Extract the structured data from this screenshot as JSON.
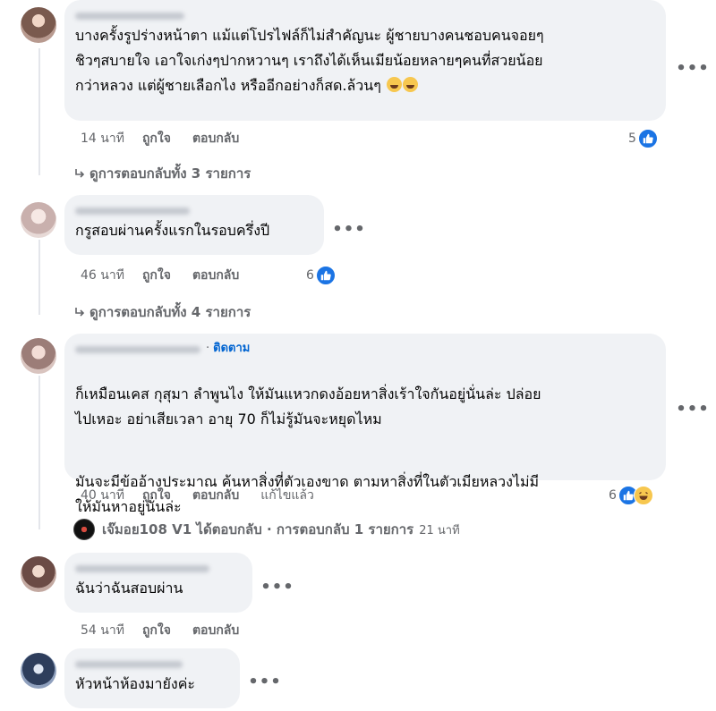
{
  "comments": [
    {
      "text": "บางครั้งรูปร่างหน้าตา แม้แต่โปรไฟล์ก็ไม่สำคัญนะ ผู้ชายบางคนชอบคนจอยๆ\nชิวๆสบายใจ เอาใจเก่งๆปากหวานๆ เราถึงได้เห็นเมียน้อยหลายๆคนที่สวยน้อย\nกว่าหลวง แต่ผู้ชายเลือกไง หรืออีกอย่างก็สด.ล้วนๆ",
      "time": "14 นาที",
      "like_label": "ถูกใจ",
      "reply_label": "ตอบกลับ",
      "reaction_count": "5",
      "view_replies": "ดูการตอบกลับทั้ง 3 รายการ"
    },
    {
      "text": "กรูสอบผ่านครั้งแรกในรอบครึ่งปี",
      "time": "46 นาที",
      "like_label": "ถูกใจ",
      "reply_label": "ตอบกลับ",
      "reaction_count": "6",
      "view_replies": "ดูการตอบกลับทั้ง 4 รายการ"
    },
    {
      "follow_sep": "·",
      "follow_label": "ติดตาม",
      "paragraph1": "ก็เหมือนเคส กุสุมา ลำพูนไง ให้มันแหวกดงอ้อยหาสิ่งเร้าใจกันอยู่นั่นล่ะ ปล่อย\nไปเหอะ อย่าเสียเวลา อายุ 70 ก็ไม่รู้มันจะหยุดไหม",
      "paragraph2": "มันจะมีข้ออ้างประมาณ ค้นหาสิ่งที่ตัวเองขาด ตามหาสิ่งที่ในตัวเมียหลวงไม่มี\nให้มันหาอยู่นั่นล่ะ",
      "time": "40 นาที",
      "like_label": "ถูกใจ",
      "reply_label": "ตอบกลับ",
      "edited_label": "แก้ไขแล้ว",
      "reaction_count": "6",
      "reply_summary": "เจ๊มอย108 V1 ได้ตอบกลับ · การตอบกลับ 1 รายการ",
      "reply_summary_time": "21 นาที"
    },
    {
      "text": "ฉันว่าฉันสอบผ่าน",
      "time": "54 นาที",
      "like_label": "ถูกใจ",
      "reply_label": "ตอบกลับ"
    },
    {
      "text": "หัวหน้าห้องมายังค่ะ"
    }
  ],
  "more_options_glyph": "•••",
  "colors": {
    "bubble": "#f0f2f5",
    "meta_text": "#65676b",
    "link_blue": "#0064d1",
    "like_blue": "#1b74e4"
  },
  "icons": {
    "like": "like-icon",
    "haha": "haha-icon",
    "more": "more-options-icon",
    "reply_arrow": "reply-arrow-icon"
  }
}
